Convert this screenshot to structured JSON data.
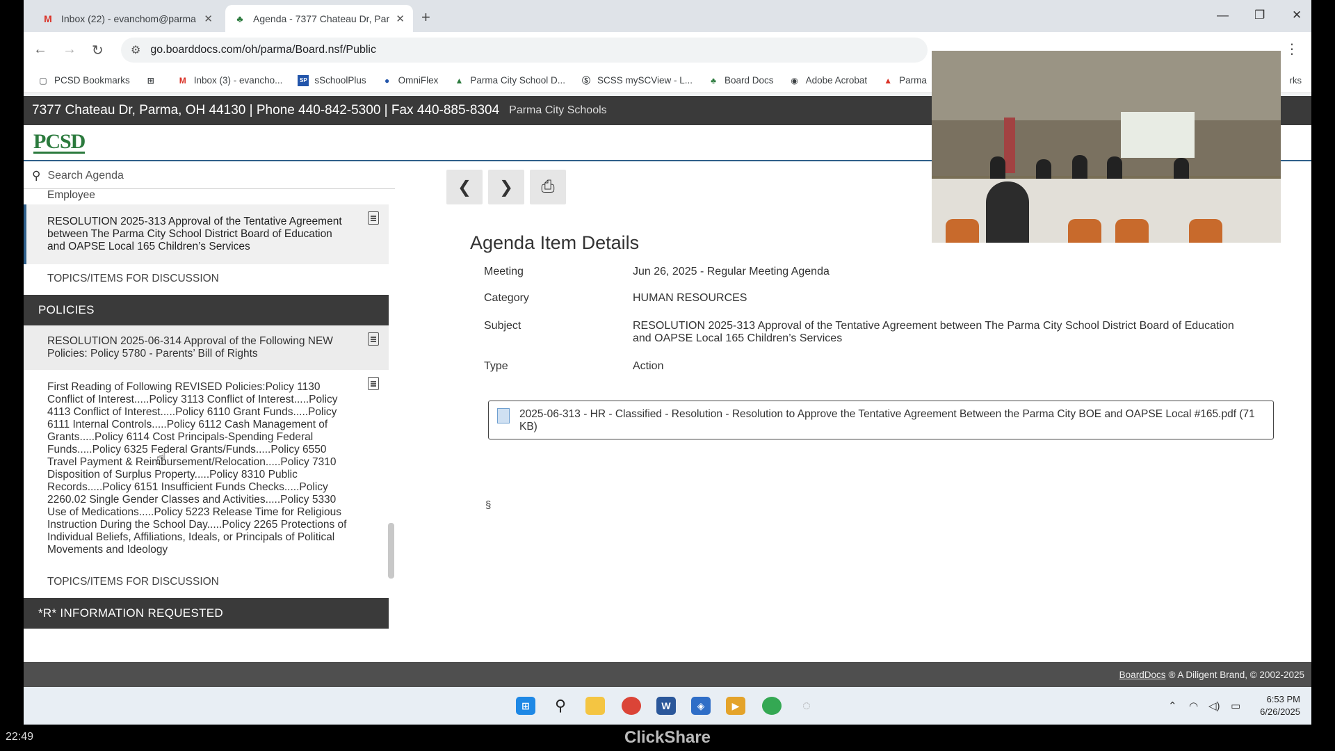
{
  "browser": {
    "tabs": [
      {
        "title": "Inbox (22) - evanchom@parma"
      },
      {
        "title": "Agenda - 7377 Chateau Dr, Par"
      }
    ],
    "url": "go.boarddocs.com/oh/parma/Board.nsf/Public",
    "bookmarks": [
      "PCSD Bookmarks",
      "Inbox (3) - evancho...",
      "sSchoolPlus",
      "OmniFlex",
      "Parma City School D...",
      "SCSS mySCView - L...",
      "Board Docs",
      "Adobe Acrobat",
      "Parma"
    ],
    "bookmarks_tail": "rks"
  },
  "page": {
    "address": "7377 Chateau Dr, Parma, OH 44130 | Phone 440-842-5300 | Fax 440-885-8304",
    "org": "Parma City Schools",
    "logo": "PCSD",
    "search_placeholder": "Search Agenda",
    "sidebar": {
      "fragment": "Employee",
      "selected_item": "RESOLUTION 2025-313 Approval of the Tentative Agreement between The Parma City School District Board of Education and OAPSE Local 165 Children’s Services",
      "topic_1": "TOPICS/ITEMS FOR DISCUSSION",
      "section_policies": "POLICIES",
      "policy_item_1": "RESOLUTION 2025-06-314 Approval of the Following NEW Policies: Policy 5780 - Parents’ Bill of Rights",
      "policy_item_2": "First Reading of Following REVISED Policies:Policy 1130 Conflict of Interest.....Policy 3113 Conflict of Interest.....Policy 4113 Conflict of Interest.....Policy 6110 Grant Funds.....Policy 6111 Internal Controls.....Policy 6112 Cash Management of Grants.....Policy 6114 Cost Principals-Spending Federal Funds.....Policy 6325 Federal Grants/Funds.....Policy 6550 Travel Payment & Reimbursement/Relocation.....Policy 7310 Disposition of Surplus Property.....Policy 8310 Public Records.....Policy 6151 Insufficient Funds Checks.....Policy 2260.02 Single Gender Classes and Activities.....Policy 5330 Use of Medications.....Policy 5223 Release Time for Religious Instruction During the School Day.....Policy 2265 Protections of Individual Beliefs, Affiliations, Ideals, or Principals of Political Movements and Ideology",
      "topic_2": "TOPICS/ITEMS FOR DISCUSSION",
      "section_info": "*R* INFORMATION REQUESTED"
    },
    "details": {
      "heading": "Agenda Item Details",
      "meeting_label": "Meeting",
      "meeting_value": "Jun 26, 2025 - Regular Meeting Agenda",
      "category_label": "Category",
      "category_value": "HUMAN RESOURCES",
      "subject_label": "Subject",
      "subject_value": "RESOLUTION 2025-313 Approval of the Tentative Agreement between The Parma City School District Board of Education and OAPSE Local 165 Children’s Services",
      "type_label": "Type",
      "type_value": "Action",
      "attachment": "2025-06-313 - HR - Classified - Resolution - Resolution to Approve the Tentative Agreement Between the Parma City BOE and OAPSE Local #165.pdf (71 KB)",
      "section_sign": "§"
    },
    "footer": {
      "brand": "BoardDocs",
      "text": "® A Diligent Brand, © 2002-2025"
    }
  },
  "taskbar": {
    "time": "6:53 PM",
    "date": "6/26/2025"
  },
  "overlay": {
    "timer": "22:49",
    "label": "ClickShare"
  },
  "colors": {
    "page_topbar": "#3a3a3a",
    "logo_green": "#2b7a3d",
    "accent_blue": "#2e5f8a"
  }
}
